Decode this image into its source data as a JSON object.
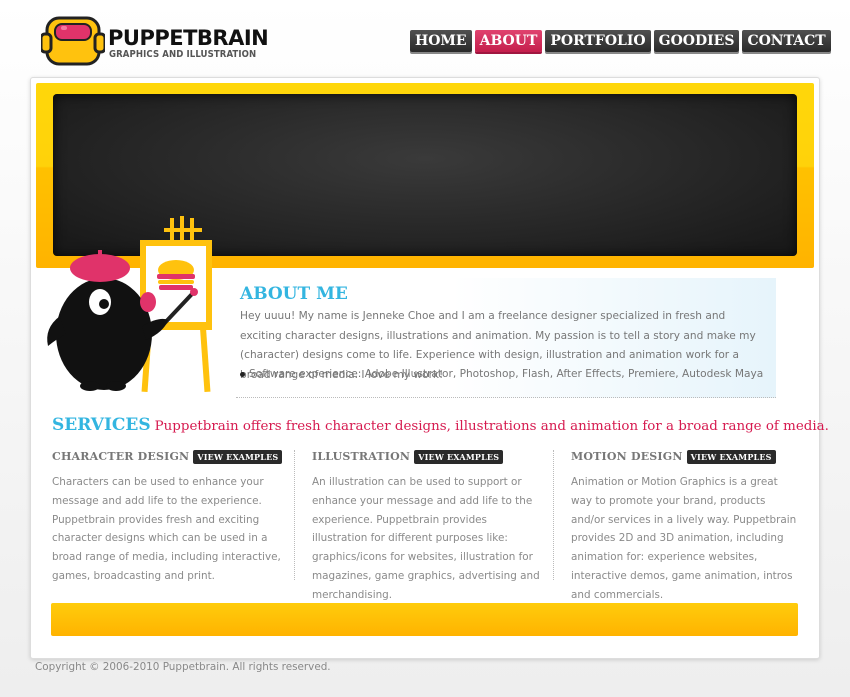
{
  "logo": {
    "name": "PUPPETBRAIN",
    "tagline": "GRAPHICS AND ILLUSTRATION"
  },
  "nav": {
    "items": [
      "HOME",
      "ABOUT",
      "PORTFOLIO",
      "GOODIES",
      "CONTACT"
    ],
    "active": "ABOUT"
  },
  "about": {
    "title": "ABOUT ME",
    "text": "Hey uuuu! My name is Jenneke Choe and I am a freelance designer specialized in fresh and exciting character designs, illustrations and animation. My passion is to tell a story and make my (character) designs come to life. Experience with design, illustration and animation work for a broad range of media. I love my work!",
    "bullet": "Software experience: Adobe Illustrator, Photoshop, Flash, After Effects, Premiere, Autodesk Maya"
  },
  "services": {
    "title": "SERVICES",
    "description": "Puppetbrain offers fresh character designs, illustrations and animation for a broad range of media.",
    "columns": [
      {
        "title": "CHARACTER DESIGN",
        "button": "VIEW EXAMPLES",
        "text": "Characters can be used to enhance your message and add life to the experience. Puppetbrain provides fresh and exciting character designs which can be used in a broad range of media, including interactive, games, broadcasting and print."
      },
      {
        "title": "ILLUSTRATION",
        "button": "VIEW EXAMPLES",
        "text": "An illustration can be used to support or enhance your message and add life to the experience. Puppetbrain provides illustration for different purposes like: graphics/icons for websites, illustration for magazines, game graphics, advertising and merchandising."
      },
      {
        "title": "MOTION DESIGN",
        "button": "VIEW EXAMPLES",
        "text": "Animation or Motion Graphics is a great way to promote your brand, products and/or services in a lively way. Puppetbrain provides 2D and 3D animation, including animation for: experience websites, interactive demos, game animation, intros and commercials."
      }
    ]
  },
  "footer": {
    "copyright": "Copyright © 2006-2010 Puppetbrain. All rights reserved."
  },
  "colors": {
    "accent_yellow": "#ffc100",
    "accent_pink": "#d61a4f",
    "accent_blue": "#33b5e0"
  }
}
